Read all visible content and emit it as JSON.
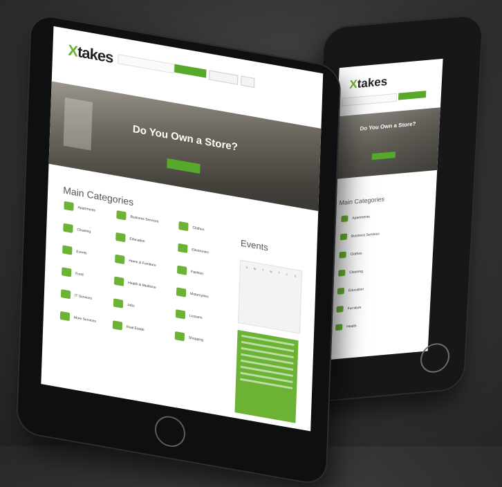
{
  "phone": {
    "logo_x": "X",
    "logo_rest": "takes",
    "hero_title": "Do You Own a Store?",
    "categories_title": "Main Categories",
    "categories": [
      "Apartments",
      "Business Services",
      "Clothes",
      "Cleaning",
      "Education",
      "Furniture",
      "Health"
    ]
  },
  "tablet": {
    "logo_x": "X",
    "logo_rest": "takes",
    "hero_title": "Do You Own a Store?",
    "categories_title": "Main Categories",
    "events_title": "Events",
    "categories": [
      "Apartments",
      "Business Services",
      "Clothes",
      "Cleaning",
      "Education",
      "Electronics",
      "Events",
      "Home & Furniture",
      "Fashion",
      "Food",
      "Health & Medicine",
      "Motorcycles",
      "IT Services",
      "Jobs",
      "Lessons",
      "More Services",
      "Real Estate",
      "Shopping"
    ],
    "calendar_days": [
      "S",
      "M",
      "T",
      "W",
      "T",
      "F",
      "S"
    ],
    "accent": "#6cb335"
  }
}
